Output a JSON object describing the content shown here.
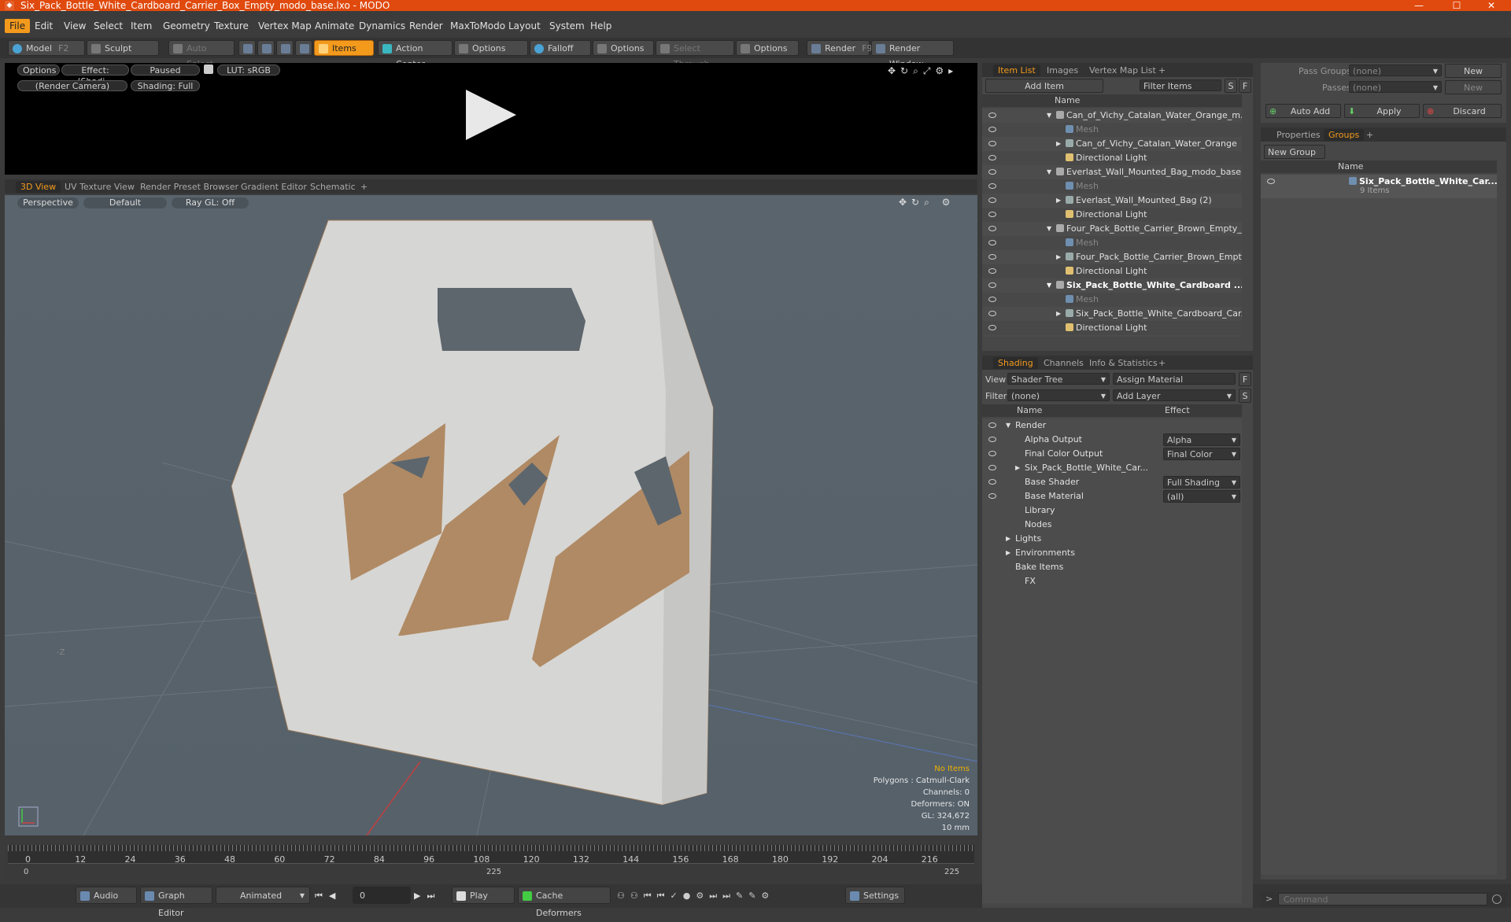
{
  "window": {
    "title": "Six_Pack_Bottle_White_Cardboard_Carrier_Box_Empty_modo_base.lxo - MODO",
    "minimize": "—",
    "maximize": "☐",
    "close": "✕"
  },
  "menu": [
    "File",
    "Edit",
    "View",
    "Select",
    "Item",
    "Geometry",
    "Texture",
    "Vertex Map",
    "Animate",
    "Dynamics",
    "Render",
    "MaxToModo",
    "Layout",
    "System",
    "Help"
  ],
  "toolbar": {
    "model": "Model",
    "model_key": "F2",
    "sculpt": "Sculpt",
    "auto_select": "Auto Select",
    "items": "Items",
    "action_center": "Action Center",
    "options1": "Options",
    "falloff": "Falloff",
    "options2": "Options",
    "select_through": "Select Through",
    "options3": "Options",
    "render": "Render",
    "render_key": "F9",
    "render_window": "Render Window"
  },
  "preview": {
    "options": "Options",
    "effect": "Effect: (Shadi...",
    "paused": "Paused",
    "lut": "LUT: sRGB",
    "camera": "(Render Camera)",
    "shading": "Shading: Full"
  },
  "view_tabs": [
    "3D View",
    "UV Texture View",
    "Render Preset Browser",
    "Gradient Editor",
    "Schematic",
    "+"
  ],
  "viewport": {
    "perspective": "Perspective",
    "default": "Default",
    "raygl": "Ray GL: Off",
    "axis_label": "-Z",
    "info": {
      "no_items": "No Items",
      "polygons": "Polygons : Catmull-Clark",
      "channels": "Channels: 0",
      "deformers": "Deformers: ON",
      "gl": "GL: 324,672",
      "scale": "10 mm"
    }
  },
  "timeline": {
    "ticks": [
      "0",
      "12",
      "24",
      "36",
      "48",
      "60",
      "72",
      "84",
      "96",
      "108",
      "120",
      "132",
      "144",
      "156",
      "168",
      "180",
      "192",
      "204",
      "216"
    ],
    "start": "0",
    "mid": "225",
    "end": "225"
  },
  "bottom": {
    "audio": "Audio",
    "graph_editor": "Graph Editor",
    "animated": "Animated",
    "frame": "0",
    "play": "Play",
    "cache": "Cache Deformers",
    "settings": "Settings"
  },
  "item_list": {
    "tabs": [
      "Item List",
      "Images",
      "Vertex Map List",
      "+"
    ],
    "add_item": "Add Item",
    "filter": "Filter Items",
    "s": "S",
    "f": "F",
    "col_name": "Name",
    "rows": [
      {
        "t": "Can_of_Vichy_Catalan_Water_Orange_m...",
        "indent": 0,
        "kind": "scene",
        "exp": "▼",
        "style": ""
      },
      {
        "t": "Mesh",
        "indent": 1,
        "kind": "mesh",
        "exp": "",
        "style": "dim"
      },
      {
        "t": "Can_of_Vichy_Catalan_Water_Orange",
        "indent": 1,
        "kind": "group",
        "exp": "▶",
        "style": ""
      },
      {
        "t": "Directional Light",
        "indent": 1,
        "kind": "light",
        "exp": "",
        "style": ""
      },
      {
        "t": "Everlast_Wall_Mounted_Bag_modo_base....",
        "indent": 0,
        "kind": "scene",
        "exp": "▼",
        "style": ""
      },
      {
        "t": "Mesh",
        "indent": 1,
        "kind": "mesh",
        "exp": "",
        "style": "dim"
      },
      {
        "t": "Everlast_Wall_Mounted_Bag (2)",
        "indent": 1,
        "kind": "group",
        "exp": "▶",
        "style": ""
      },
      {
        "t": "Directional Light",
        "indent": 1,
        "kind": "light",
        "exp": "",
        "style": ""
      },
      {
        "t": "Four_Pack_Bottle_Carrier_Brown_Empty_...",
        "indent": 0,
        "kind": "scene",
        "exp": "▼",
        "style": ""
      },
      {
        "t": "Mesh",
        "indent": 1,
        "kind": "mesh",
        "exp": "",
        "style": "dim"
      },
      {
        "t": "Four_Pack_Bottle_Carrier_Brown_Empt...",
        "indent": 1,
        "kind": "group",
        "exp": "▶",
        "style": ""
      },
      {
        "t": "Directional Light",
        "indent": 1,
        "kind": "light",
        "exp": "",
        "style": ""
      },
      {
        "t": "Six_Pack_Bottle_White_Cardboard ...",
        "indent": 0,
        "kind": "scene",
        "exp": "▼",
        "style": "bold"
      },
      {
        "t": "Mesh",
        "indent": 1,
        "kind": "mesh",
        "exp": "",
        "style": "dim"
      },
      {
        "t": "Six_Pack_Bottle_White_Cardboard_Car...",
        "indent": 1,
        "kind": "group",
        "exp": "▶",
        "style": ""
      },
      {
        "t": "Directional Light",
        "indent": 1,
        "kind": "light",
        "exp": "",
        "style": ""
      }
    ]
  },
  "shading": {
    "tabs": [
      "Shading",
      "Channels",
      "Info & Statistics",
      "+"
    ],
    "view_label": "View",
    "view_value": "Shader Tree",
    "assign": "Assign Material",
    "f": "F",
    "filter_label": "Filter",
    "filter_value": "(none)",
    "add_layer": "Add Layer",
    "s": "S",
    "col_name": "Name",
    "col_effect": "Effect",
    "rows": [
      {
        "t": "Render",
        "effect": "",
        "indent": 0,
        "exp": "▼",
        "eye": true
      },
      {
        "t": "Alpha Output",
        "effect": "Alpha",
        "indent": 1,
        "exp": "",
        "eye": true
      },
      {
        "t": "Final Color Output",
        "effect": "Final Color",
        "indent": 1,
        "exp": "",
        "eye": true
      },
      {
        "t": "Six_Pack_Bottle_White_Car...",
        "effect": "",
        "indent": 1,
        "exp": "▶",
        "eye": true
      },
      {
        "t": "Base Shader",
        "effect": "Full Shading",
        "indent": 1,
        "exp": "",
        "eye": true
      },
      {
        "t": "Base Material",
        "effect": "(all)",
        "indent": 1,
        "exp": "",
        "eye": true
      },
      {
        "t": "Library",
        "effect": "",
        "indent": 1,
        "exp": "",
        "eye": false
      },
      {
        "t": "Nodes",
        "effect": "",
        "indent": 1,
        "exp": "",
        "eye": false
      },
      {
        "t": "Lights",
        "effect": "",
        "indent": 0,
        "exp": "▶",
        "eye": false
      },
      {
        "t": "Environments",
        "effect": "",
        "indent": 0,
        "exp": "▶",
        "eye": false
      },
      {
        "t": "Bake Items",
        "effect": "",
        "indent": 0,
        "exp": "",
        "eye": false
      },
      {
        "t": "FX",
        "effect": "",
        "indent": 1,
        "exp": "",
        "eye": false
      }
    ]
  },
  "pass": {
    "pass_groups": "Pass Groups",
    "passes": "Passes",
    "none1": "(none)",
    "none2": "(none)",
    "new1": "New",
    "new2": "New",
    "auto_add": "Auto Add",
    "apply": "Apply",
    "discard": "Discard"
  },
  "groups": {
    "tabs": [
      "Properties",
      "Groups",
      "+"
    ],
    "new_group": "New Group",
    "col_name": "Name",
    "item_name": "Six_Pack_Bottle_White_Car...",
    "item_count": "9 Items"
  },
  "command": {
    "placeholder": "Command",
    "prompt": ">"
  }
}
